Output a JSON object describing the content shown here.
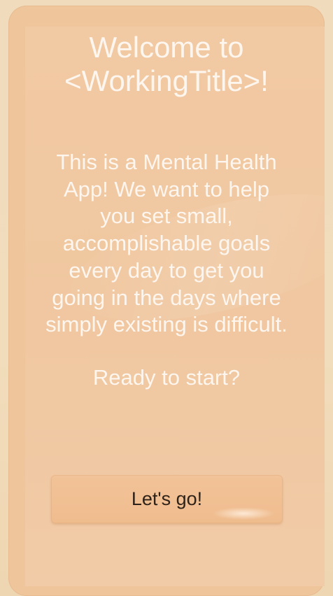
{
  "welcome": {
    "title_line1": "Welcome to",
    "title_line2": "<WorkingTitle>!",
    "description_lines": [
      "This is a Mental Health",
      "App! We want to help",
      "you set small,",
      "accomplishable goals",
      "every day to get you",
      "going in the days where",
      "simply existing is difficult."
    ],
    "prompt": "Ready to start?",
    "start_button_label": "Let's go!"
  }
}
